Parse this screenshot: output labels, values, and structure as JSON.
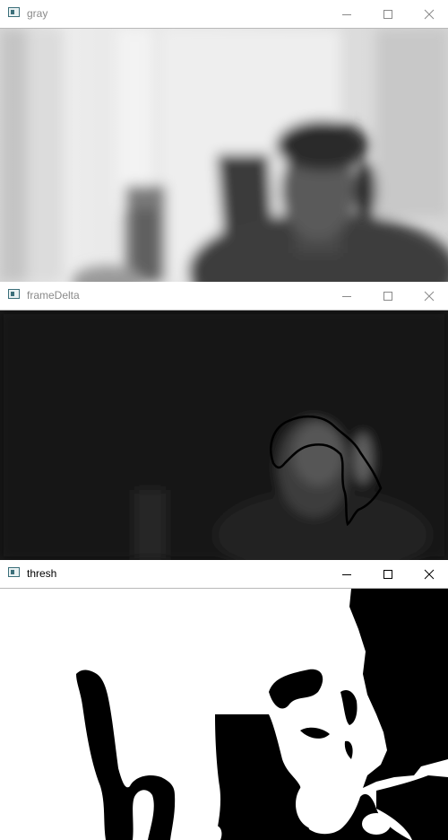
{
  "windows": [
    {
      "title": "gray",
      "active": false
    },
    {
      "title": "frameDelta",
      "active": false
    },
    {
      "title": "thresh",
      "active": true
    }
  ],
  "controls": {
    "minimize_icon": "minimize-icon",
    "maximize_icon": "maximize-icon",
    "close_icon": "close-icon"
  }
}
